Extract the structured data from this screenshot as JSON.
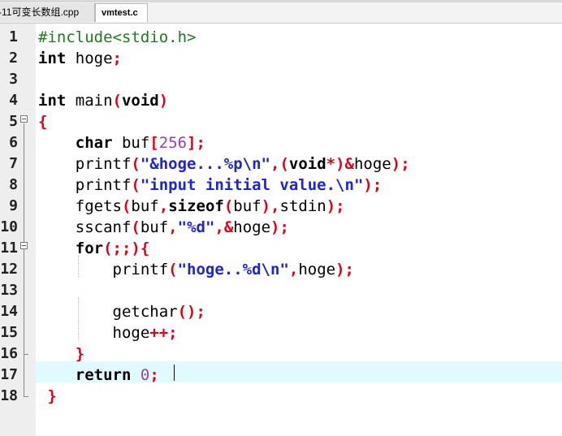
{
  "tabs": [
    {
      "label": "-11可变长数组.cpp",
      "active": false
    },
    {
      "label": "vmtest.c",
      "active": true
    }
  ],
  "editor": {
    "current_line": 17,
    "lines": [
      {
        "n": "1",
        "tokens": [
          [
            "pp",
            "#include<stdio.h>"
          ]
        ]
      },
      {
        "n": "2",
        "tokens": [
          [
            "kw",
            "int"
          ],
          [
            "id",
            " hoge"
          ],
          [
            "op",
            ";"
          ]
        ]
      },
      {
        "n": "3",
        "tokens": []
      },
      {
        "n": "4",
        "tokens": [
          [
            "kw",
            "int"
          ],
          [
            "id",
            " main"
          ],
          [
            "op",
            "("
          ],
          [
            "kw",
            "void"
          ],
          [
            "op",
            ")"
          ]
        ]
      },
      {
        "n": "5",
        "tokens": [
          [
            "op",
            "{"
          ]
        ]
      },
      {
        "n": "6",
        "tokens": [
          [
            "id",
            "    "
          ],
          [
            "kw",
            "char"
          ],
          [
            "id",
            " buf"
          ],
          [
            "op",
            "["
          ],
          [
            "num",
            "256"
          ],
          [
            "op",
            "];"
          ]
        ]
      },
      {
        "n": "7",
        "tokens": [
          [
            "id",
            "    printf"
          ],
          [
            "op",
            "("
          ],
          [
            "str",
            "\"&hoge...%p\\n\""
          ],
          [
            "op",
            ",("
          ],
          [
            "kw",
            "void"
          ],
          [
            "op",
            "*)&"
          ],
          [
            "id",
            "hoge"
          ],
          [
            "op",
            ");"
          ]
        ]
      },
      {
        "n": "8",
        "tokens": [
          [
            "id",
            "    printf"
          ],
          [
            "op",
            "("
          ],
          [
            "str",
            "\"input initial value.\\n\""
          ],
          [
            "op",
            ");"
          ]
        ]
      },
      {
        "n": "9",
        "tokens": [
          [
            "id",
            "    fgets"
          ],
          [
            "op",
            "("
          ],
          [
            "id",
            "buf"
          ],
          [
            "op",
            ","
          ],
          [
            "kw",
            "sizeof"
          ],
          [
            "op",
            "("
          ],
          [
            "id",
            "buf"
          ],
          [
            "op",
            "),"
          ],
          [
            "id",
            "stdin"
          ],
          [
            "op",
            ");"
          ]
        ]
      },
      {
        "n": "10",
        "tokens": [
          [
            "id",
            "    sscanf"
          ],
          [
            "op",
            "("
          ],
          [
            "id",
            "buf"
          ],
          [
            "op",
            ","
          ],
          [
            "str",
            "\"%d\""
          ],
          [
            "op",
            ",&"
          ],
          [
            "id",
            "hoge"
          ],
          [
            "op",
            ");"
          ]
        ]
      },
      {
        "n": "11",
        "tokens": [
          [
            "id",
            "    "
          ],
          [
            "kw",
            "for"
          ],
          [
            "op",
            "(;;){"
          ]
        ]
      },
      {
        "n": "12",
        "tokens": [
          [
            "id",
            "        printf"
          ],
          [
            "op",
            "("
          ],
          [
            "str",
            "\"hoge..%d\\n\""
          ],
          [
            "op",
            ","
          ],
          [
            "id",
            "hoge"
          ],
          [
            "op",
            ");"
          ]
        ]
      },
      {
        "n": "13",
        "tokens": []
      },
      {
        "n": "14",
        "tokens": [
          [
            "id",
            "        getchar"
          ],
          [
            "op",
            "();"
          ]
        ]
      },
      {
        "n": "15",
        "tokens": [
          [
            "id",
            "        hoge"
          ],
          [
            "op",
            "++;"
          ]
        ]
      },
      {
        "n": "16",
        "tokens": [
          [
            "id",
            "    "
          ],
          [
            "op",
            "}"
          ]
        ]
      },
      {
        "n": "17",
        "tokens": [
          [
            "id",
            "    "
          ],
          [
            "kw",
            "return"
          ],
          [
            "id",
            " "
          ],
          [
            "num",
            "0"
          ],
          [
            "op",
            ";"
          ]
        ]
      },
      {
        "n": "18",
        "tokens": [
          [
            "id",
            " "
          ],
          [
            "op",
            "}"
          ]
        ]
      }
    ]
  }
}
